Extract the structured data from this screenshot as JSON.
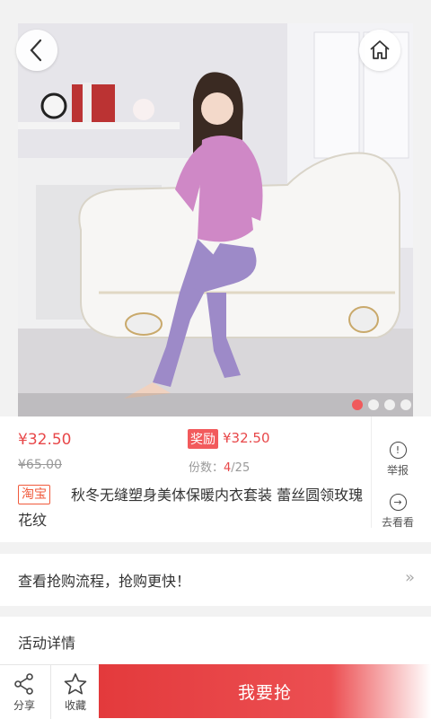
{
  "nav": {
    "back_icon": "chevron-left-icon",
    "home_icon": "home-icon"
  },
  "gallery": {
    "dots": 4,
    "active_dot": 0,
    "active_color": "#f05a5c"
  },
  "product": {
    "price": "¥32.50",
    "original_price": "¥65.00",
    "reward_label": "奖励",
    "reward_price": "¥32.50",
    "shares_label": "份数：",
    "shares_current": "4",
    "shares_total": "/25",
    "platform_tag": "淘宝",
    "title": "秋冬无缝塑身美体保暖内衣套装 蕾丝圆领玫瑰花纹"
  },
  "side_actions": {
    "report_label": "举报",
    "goto_label": "去看看"
  },
  "flow": {
    "label": "查看抢购流程，抢购更快！",
    "arrow": "»"
  },
  "details": {
    "label": "活动详情"
  },
  "bottom_bar": {
    "share_label": "分享",
    "favorite_label": "收藏",
    "grab_label": "我要抢"
  },
  "colors": {
    "accent": "#e8484a",
    "grab_button": "#e33a3c"
  }
}
